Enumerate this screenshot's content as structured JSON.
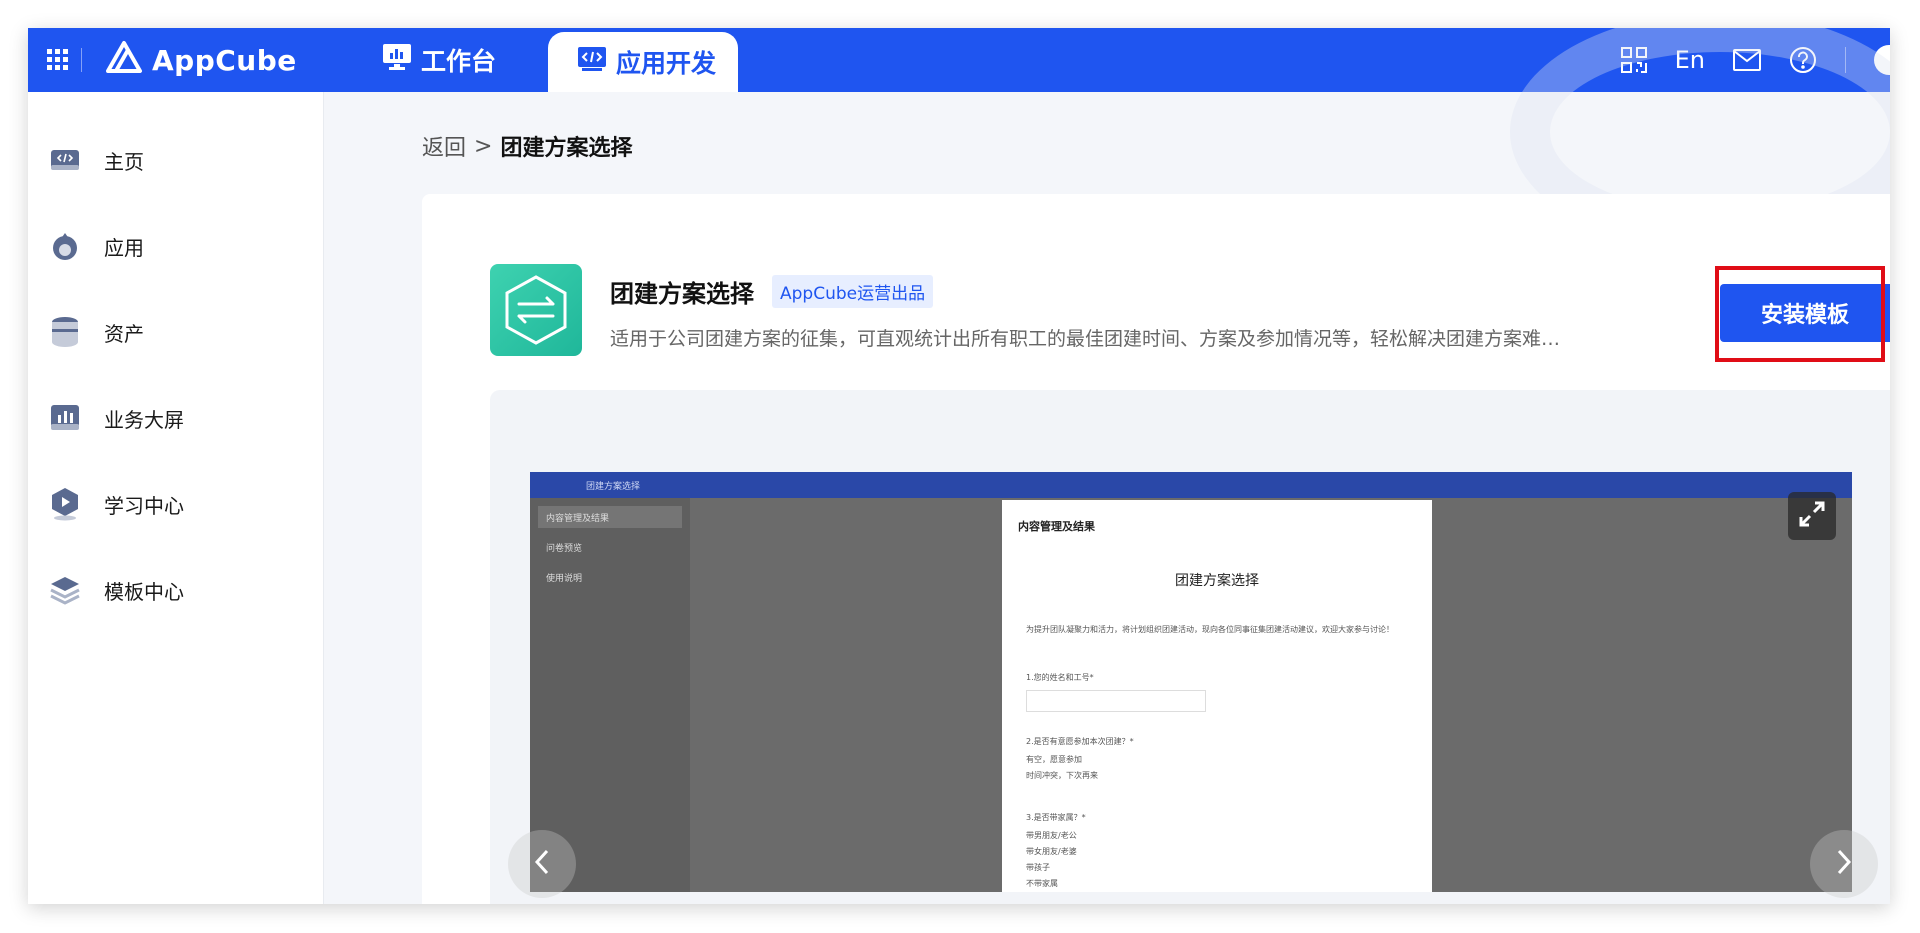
{
  "topbar": {
    "logo_text": "AppCube",
    "tab_workbench": "工作台",
    "tab_appdev": "应用开发",
    "lang": "En"
  },
  "sidebar": {
    "items": [
      {
        "label": "主页",
        "icon": "code-icon"
      },
      {
        "label": "应用",
        "icon": "app-drop-icon"
      },
      {
        "label": "资产",
        "icon": "database-icon"
      },
      {
        "label": "业务大屏",
        "icon": "chart-screen-icon"
      },
      {
        "label": "学习中心",
        "icon": "learning-icon"
      },
      {
        "label": "模板中心",
        "icon": "layers-icon"
      }
    ]
  },
  "breadcrumb": {
    "back": "返回",
    "sep": ">",
    "current": "团建方案选择"
  },
  "template": {
    "title": "团建方案选择",
    "badge": "AppCube运营出品",
    "description": "适用于公司团建方案的征集，可直观统计出所有职工的最佳团建时间、方案及参加情况等，轻松解决团建方案难…",
    "install_label": "安装模板"
  },
  "preview": {
    "shot_app_title": "团建方案选择",
    "shot_sidebar": [
      "内容管理及结果",
      "问卷预览",
      "使用说明"
    ],
    "shot_modal_header": "内容管理及结果",
    "shot_modal_title": "团建方案选择",
    "shot_modal_intro": "为提升团队凝聚力和活力，将计划组织团建活动，现向各位同事征集团建活动建议，欢迎大家参与讨论！",
    "shot_q1": "1.您的姓名和工号*",
    "shot_q2": "2.是否有意愿参加本次团建？*",
    "shot_q2_opts": [
      "有空，愿意参加",
      "时间冲突，下次再来"
    ],
    "shot_q3": "3.是否带家属？*",
    "shot_q3_opts": [
      "带男朋友/老公",
      "带女朋友/老婆",
      "带孩子",
      "不带家属"
    ]
  },
  "colors": {
    "brand": "#1f55f0",
    "highlight": "#e00d16",
    "app_icon": "#2cc6a6"
  }
}
